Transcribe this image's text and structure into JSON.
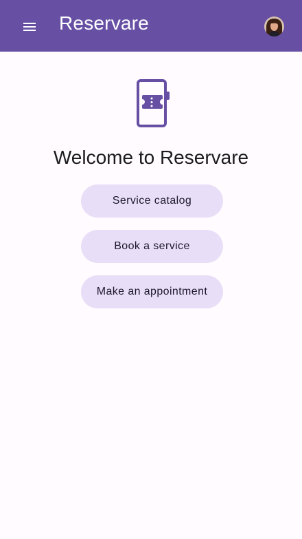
{
  "app_bar": {
    "title": "Reservare",
    "menu_icon": "hamburger-menu-icon",
    "avatar_icon": "user-avatar"
  },
  "main": {
    "hero_icon": "booking-ticket-phone-icon",
    "welcome": "Welcome to Reservare",
    "actions": [
      {
        "label": "Service catalog"
      },
      {
        "label": "Book a service"
      },
      {
        "label": "Make an appointment"
      }
    ]
  },
  "colors": {
    "primary": "#6750a4",
    "background": "#fffbfe",
    "button_bg": "#e8def8",
    "button_text": "#1d192b",
    "text": "#1c1b1f"
  }
}
